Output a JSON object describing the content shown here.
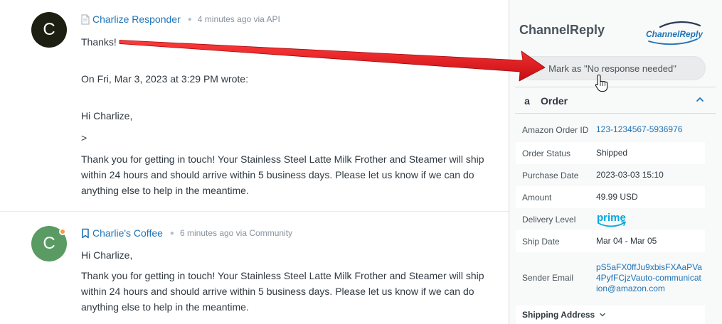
{
  "messages": [
    {
      "avatar_letter": "C",
      "author": "Charlize Responder",
      "meta": "4 minutes ago via API",
      "lines": {
        "thanks": "Thanks!",
        "on_wrote": "On Fri, Mar 3, 2023 at 3:29 PM wrote:",
        "greeting": "Hi Charlize,",
        "quote_marker": ">",
        "paragraph": "Thank you for getting in touch! Your Stainless Steel Latte Milk Frother and Steamer will ship within 24 hours and should arrive within 5 business days. Please let us know if we can do anything else to help in the meantime."
      }
    },
    {
      "avatar_letter": "C",
      "author": "Charlie's Coffee",
      "meta": "6 minutes ago via Community",
      "lines": {
        "greeting": "Hi Charlize,",
        "paragraph": "Thank you for getting in touch! Your Stainless Steel Latte Milk Frother and Steamer will ship within 24 hours and should arrive within 5 business days. Please let us know if we can do anything else to help in the meantime."
      }
    }
  ],
  "sidebar": {
    "app_title": "ChannelReply",
    "logo_text": "ChannelReply",
    "mark_button": "Mark as \"No response needed\"",
    "order": {
      "icon_glyph": "a",
      "title": "Order",
      "rows": [
        {
          "key": "Amazon Order ID",
          "value": "123-1234567-5936976"
        },
        {
          "key": "Order Status",
          "value": "Shipped"
        },
        {
          "key": "Purchase Date",
          "value": "2023-03-03 15:10"
        },
        {
          "key": "Amount",
          "value": "49.99 USD"
        },
        {
          "key": "Delivery Level",
          "value": "prime"
        },
        {
          "key": "Ship Date",
          "value": "Mar 04 - Mar 05"
        },
        {
          "key": "Sender Email",
          "value": "pS5aFX0ffJu9xbisFXAaPVa4PyfFCjzVauto-communication@amazon.com"
        }
      ]
    },
    "shipping_address": "Shipping Address"
  },
  "colors": {
    "link": "#1f73b7",
    "annotation_arrow": "#e0161c",
    "prime_blue": "#00a8e1",
    "presence": "#f79a3e"
  },
  "icons": {
    "msg1_channel": "document-icon",
    "msg2_channel": "bookmark-icon",
    "collapse": "chevron-up-icon",
    "shipping_toggle": "chevron-down-icon",
    "cursor": "hand-pointer-icon"
  }
}
